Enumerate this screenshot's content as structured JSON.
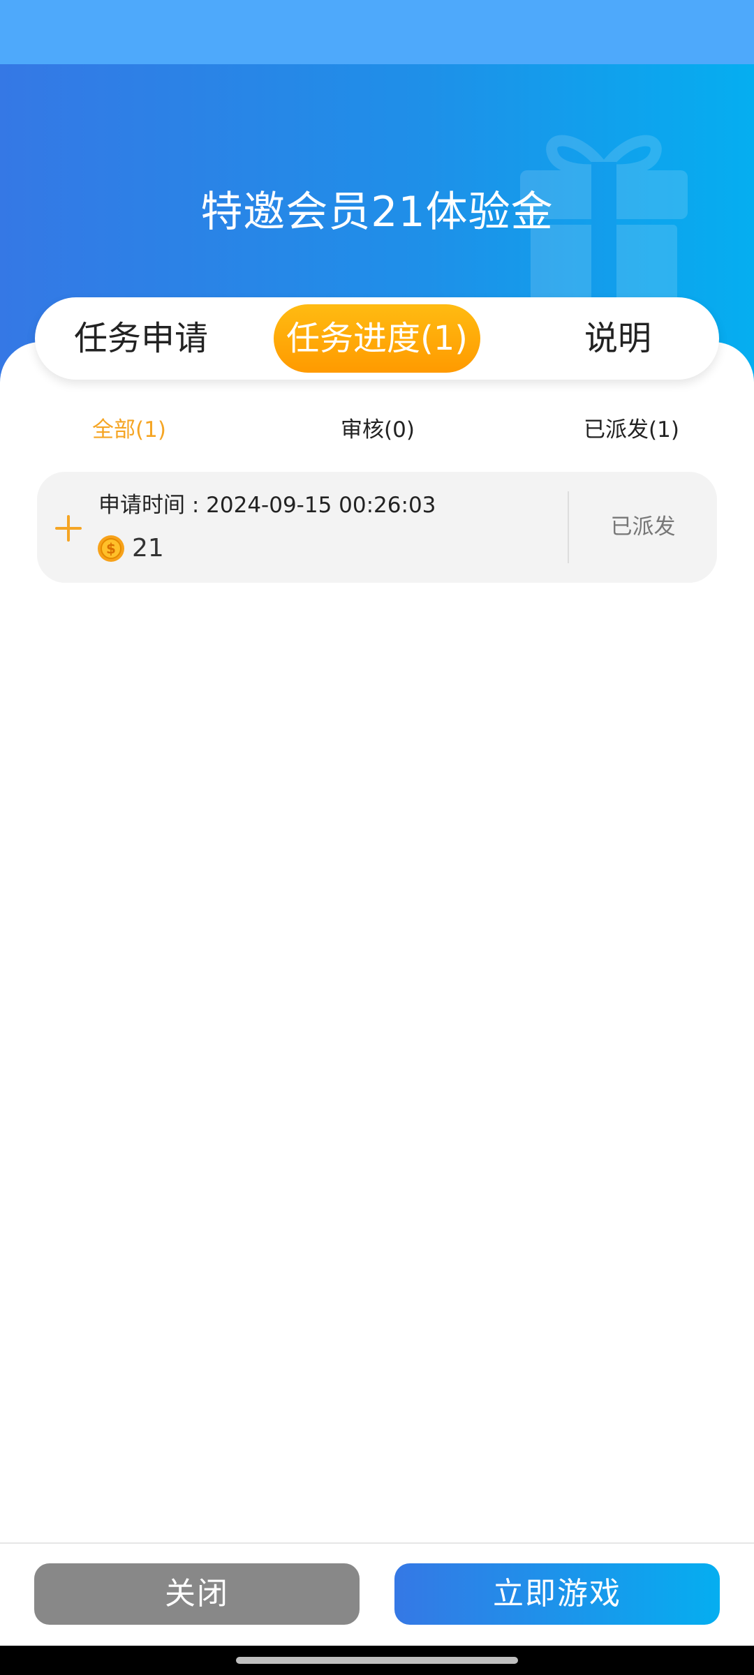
{
  "header": {
    "title": "特邀会员21体验金"
  },
  "tabs": {
    "apply": "任务申请",
    "progress": "任务进度(1)",
    "description": "说明"
  },
  "filters": {
    "all": "全部(1)",
    "review": "审核(0)",
    "dispatched": "已派发(1)"
  },
  "record": {
    "apply_time": "申请时间 : 2024-09-15 00:26:03",
    "amount": "21",
    "status": "已派发"
  },
  "buttons": {
    "close": "关闭",
    "play_now": "立即游戏"
  },
  "colors": {
    "accent_orange": "#ff9a00",
    "header_blue_start": "#3578e5",
    "header_blue_end": "#05aef0",
    "close_button_gray": "#888888"
  },
  "icons": {
    "gift": "gift-icon",
    "expand": "plus-icon",
    "coin": "coin-icon"
  }
}
